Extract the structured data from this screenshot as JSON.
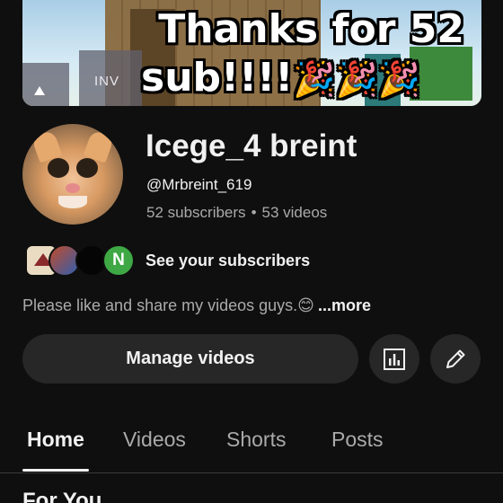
{
  "banner": {
    "title_line1": "Thanks for 52",
    "title_line2": "sub!!!!",
    "emojis": "🎉🎉🎉",
    "inv_label": "INV"
  },
  "channel": {
    "name": "Icege_4 breint",
    "handle": "@Mrbreint_619",
    "subscribers": "52 subscribers",
    "separator": "•",
    "videos": "53 videos"
  },
  "subscribers_row": {
    "last_avatar_initial": "N",
    "link_label": "See your subscribers"
  },
  "description": {
    "text": "Please like and share my videos guys.😊",
    "more_label": "...more"
  },
  "actions": {
    "manage_label": "Manage videos",
    "analytics_icon": "analytics-icon",
    "edit_icon": "pencil-icon"
  },
  "tabs": [
    {
      "label": "Home",
      "active": true
    },
    {
      "label": "Videos",
      "active": false
    },
    {
      "label": "Shorts",
      "active": false
    },
    {
      "label": "Posts",
      "active": false
    }
  ],
  "section": {
    "title": "For You"
  },
  "colors": {
    "background": "#0f0f0f",
    "button_bg": "#272727",
    "secondary_text": "#aaaaaa",
    "primary_text": "#f1f1f1"
  }
}
